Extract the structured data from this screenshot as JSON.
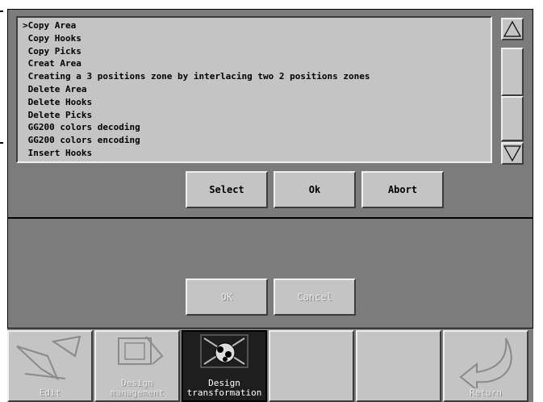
{
  "list": {
    "items": [
      ">Copy Area",
      " Copy Hooks",
      " Copy Picks",
      " Creat Area",
      " Creating a 3 positions zone by interlacing two 2 positions zones",
      " Delete Area",
      " Delete Hooks",
      " Delete Picks",
      " GG200 colors decoding",
      " GG200 colors encoding",
      " Insert Hooks"
    ]
  },
  "scrollbar": {
    "up_icon": "triangle-up-icon",
    "down_icon": "triangle-down-icon"
  },
  "actions": {
    "select_label": "Select",
    "ok_label": "Ok",
    "abort_label": "Abort"
  },
  "dialog": {
    "ok_label": "OK",
    "cancel_label": "Cancel"
  },
  "toolbar": {
    "items": [
      {
        "label": "Edit",
        "icon": "edit-hand-icon",
        "state": "disabled"
      },
      {
        "label": "Design\nmanagement",
        "icon": "design-management-icon",
        "state": "disabled"
      },
      {
        "label": "Design\ntransformation",
        "icon": "design-transformation-icon",
        "state": "active"
      },
      {
        "label": "",
        "icon": "",
        "state": "empty"
      },
      {
        "label": "",
        "icon": "",
        "state": "empty"
      },
      {
        "label": "Return",
        "icon": "return-arrow-icon",
        "state": "disabled"
      }
    ]
  },
  "colors": {
    "panel": "#7c7c7c",
    "button": "#c4c4c4",
    "active_tool": "#1e1e1e"
  }
}
